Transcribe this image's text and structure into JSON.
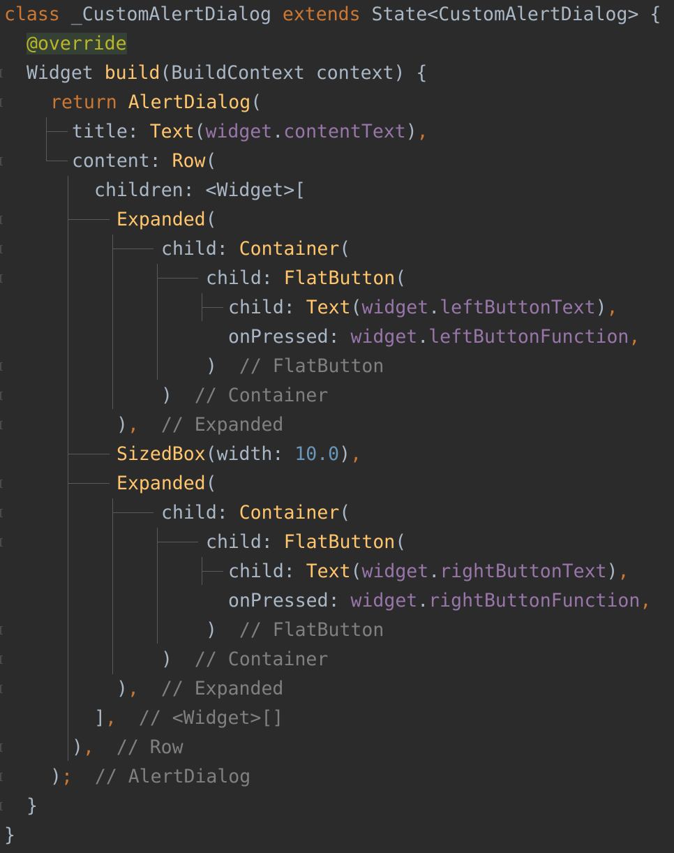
{
  "editor": {
    "background": "#2b2b2b",
    "colors": {
      "keyword": "#cc7832",
      "plain": "#a9b7c6",
      "function": "#ffc66d",
      "annotation": "#bbb529",
      "field": "#9876aa",
      "comment": "#808080",
      "number": "#6897bb"
    },
    "lines": [
      [
        {
          "c": "kw",
          "t": "class"
        },
        {
          "c": "plain",
          "t": " _CustomAlertDialog "
        },
        {
          "c": "kw",
          "t": "extends"
        },
        {
          "c": "plain",
          "t": " State<CustomAlertDialog> {"
        }
      ],
      [
        {
          "c": "ann",
          "t": "@override"
        }
      ],
      [
        {
          "c": "plain",
          "t": "Widget "
        },
        {
          "c": "fn",
          "t": "build"
        },
        {
          "c": "plain",
          "t": "(BuildContext context) {"
        }
      ],
      [
        {
          "c": "kw",
          "t": "return "
        },
        {
          "c": "fn",
          "t": "AlertDialog"
        },
        {
          "c": "plain",
          "t": "("
        }
      ],
      [
        {
          "c": "plain",
          "t": "title: "
        },
        {
          "c": "fn",
          "t": "Text"
        },
        {
          "c": "plain",
          "t": "("
        },
        {
          "c": "field",
          "t": "widget"
        },
        {
          "c": "plain",
          "t": "."
        },
        {
          "c": "field",
          "t": "contentText"
        },
        {
          "c": "plain",
          "t": ")"
        },
        {
          "c": "kw",
          "t": ","
        }
      ],
      [
        {
          "c": "plain",
          "t": "content: "
        },
        {
          "c": "fn",
          "t": "Row"
        },
        {
          "c": "plain",
          "t": "("
        }
      ],
      [
        {
          "c": "plain",
          "t": "children: <Widget>["
        }
      ],
      [
        {
          "c": "fn",
          "t": "Expanded"
        },
        {
          "c": "plain",
          "t": "("
        }
      ],
      [
        {
          "c": "plain",
          "t": "child: "
        },
        {
          "c": "fn",
          "t": "Container"
        },
        {
          "c": "plain",
          "t": "("
        }
      ],
      [
        {
          "c": "plain",
          "t": "child: "
        },
        {
          "c": "fn",
          "t": "FlatButton"
        },
        {
          "c": "plain",
          "t": "("
        }
      ],
      [
        {
          "c": "plain",
          "t": "child: "
        },
        {
          "c": "fn",
          "t": "Text"
        },
        {
          "c": "plain",
          "t": "("
        },
        {
          "c": "field",
          "t": "widget"
        },
        {
          "c": "plain",
          "t": "."
        },
        {
          "c": "field",
          "t": "leftButtonText"
        },
        {
          "c": "plain",
          "t": ")"
        },
        {
          "c": "kw",
          "t": ","
        }
      ],
      [
        {
          "c": "plain",
          "t": "onPressed: "
        },
        {
          "c": "field",
          "t": "widget"
        },
        {
          "c": "plain",
          "t": "."
        },
        {
          "c": "field",
          "t": "leftButtonFunction"
        },
        {
          "c": "kw",
          "t": ","
        }
      ],
      [
        {
          "c": "plain",
          "t": ")  "
        },
        {
          "c": "cmt",
          "t": "// FlatButton"
        }
      ],
      [
        {
          "c": "plain",
          "t": ")  "
        },
        {
          "c": "cmt",
          "t": "// Container"
        }
      ],
      [
        {
          "c": "plain",
          "t": ")"
        },
        {
          "c": "kw",
          "t": ","
        },
        {
          "c": "plain",
          "t": "  "
        },
        {
          "c": "cmt",
          "t": "// Expanded"
        }
      ],
      [
        {
          "c": "fn",
          "t": "SizedBox"
        },
        {
          "c": "plain",
          "t": "(width: "
        },
        {
          "c": "num",
          "t": "10.0"
        },
        {
          "c": "plain",
          "t": ")"
        },
        {
          "c": "kw",
          "t": ","
        }
      ],
      [
        {
          "c": "fn",
          "t": "Expanded"
        },
        {
          "c": "plain",
          "t": "("
        }
      ],
      [
        {
          "c": "plain",
          "t": "child: "
        },
        {
          "c": "fn",
          "t": "Container"
        },
        {
          "c": "plain",
          "t": "("
        }
      ],
      [
        {
          "c": "plain",
          "t": "child: "
        },
        {
          "c": "fn",
          "t": "FlatButton"
        },
        {
          "c": "plain",
          "t": "("
        }
      ],
      [
        {
          "c": "plain",
          "t": "child: "
        },
        {
          "c": "fn",
          "t": "Text"
        },
        {
          "c": "plain",
          "t": "("
        },
        {
          "c": "field",
          "t": "widget"
        },
        {
          "c": "plain",
          "t": "."
        },
        {
          "c": "field",
          "t": "rightButtonText"
        },
        {
          "c": "plain",
          "t": ")"
        },
        {
          "c": "kw",
          "t": ","
        }
      ],
      [
        {
          "c": "plain",
          "t": "onPressed: "
        },
        {
          "c": "field",
          "t": "widget"
        },
        {
          "c": "plain",
          "t": "."
        },
        {
          "c": "field",
          "t": "rightButtonFunction"
        },
        {
          "c": "kw",
          "t": ","
        }
      ],
      [
        {
          "c": "plain",
          "t": ")  "
        },
        {
          "c": "cmt",
          "t": "// FlatButton"
        }
      ],
      [
        {
          "c": "plain",
          "t": ")  "
        },
        {
          "c": "cmt",
          "t": "// Container"
        }
      ],
      [
        {
          "c": "plain",
          "t": ")"
        },
        {
          "c": "kw",
          "t": ","
        },
        {
          "c": "plain",
          "t": "  "
        },
        {
          "c": "cmt",
          "t": "// Expanded"
        }
      ],
      [
        {
          "c": "plain",
          "t": "]"
        },
        {
          "c": "kw",
          "t": ","
        },
        {
          "c": "plain",
          "t": "  "
        },
        {
          "c": "cmt",
          "t": "// <Widget>[]"
        }
      ],
      [
        {
          "c": "plain",
          "t": ")"
        },
        {
          "c": "kw",
          "t": ","
        },
        {
          "c": "plain",
          "t": "  "
        },
        {
          "c": "cmt",
          "t": "// Row"
        }
      ],
      [
        {
          "c": "plain",
          "t": ")"
        },
        {
          "c": "kw",
          "t": ";"
        },
        {
          "c": "plain",
          "t": "  "
        },
        {
          "c": "cmt",
          "t": "// AlertDialog"
        }
      ],
      [
        {
          "c": "plain",
          "t": "}"
        }
      ],
      [
        {
          "c": "plain",
          "t": "}"
        }
      ]
    ]
  }
}
